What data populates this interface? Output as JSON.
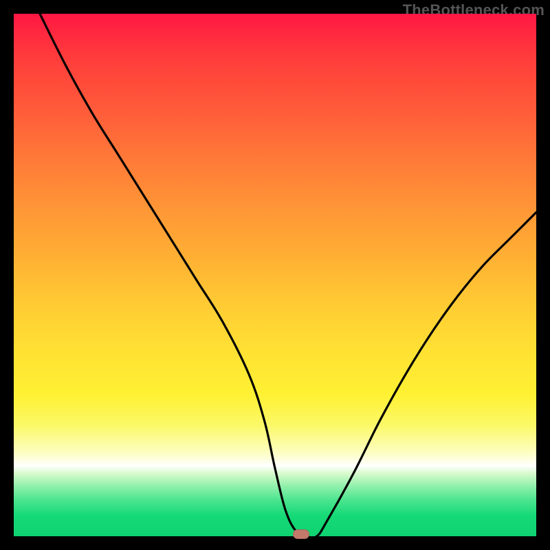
{
  "watermark": "TheBottleneck.com",
  "chart_data": {
    "type": "line",
    "title": "",
    "xlabel": "",
    "ylabel": "",
    "xlim": [
      0,
      100
    ],
    "ylim": [
      0,
      100
    ],
    "grid": false,
    "legend": false,
    "series": [
      {
        "name": "bottleneck-curve",
        "x": [
          5,
          10,
          15,
          20,
          25,
          30,
          35,
          40,
          45,
          48,
          50,
          52,
          54,
          56,
          58,
          60,
          65,
          70,
          75,
          80,
          85,
          90,
          95,
          100
        ],
        "values": [
          100,
          90,
          81,
          73,
          65,
          57,
          49,
          41,
          31,
          22,
          13,
          5,
          1,
          0,
          0,
          3,
          12,
          22,
          31,
          39,
          46,
          52,
          57,
          62
        ]
      }
    ],
    "bottleneck_marker": {
      "x": 55,
      "y": 0
    },
    "colors": {
      "curve": "#000000",
      "marker": "#c47a6b",
      "gradient_top": "#ff1744",
      "gradient_mid": "#ffe433",
      "gradient_bottom": "#0ed370"
    }
  }
}
